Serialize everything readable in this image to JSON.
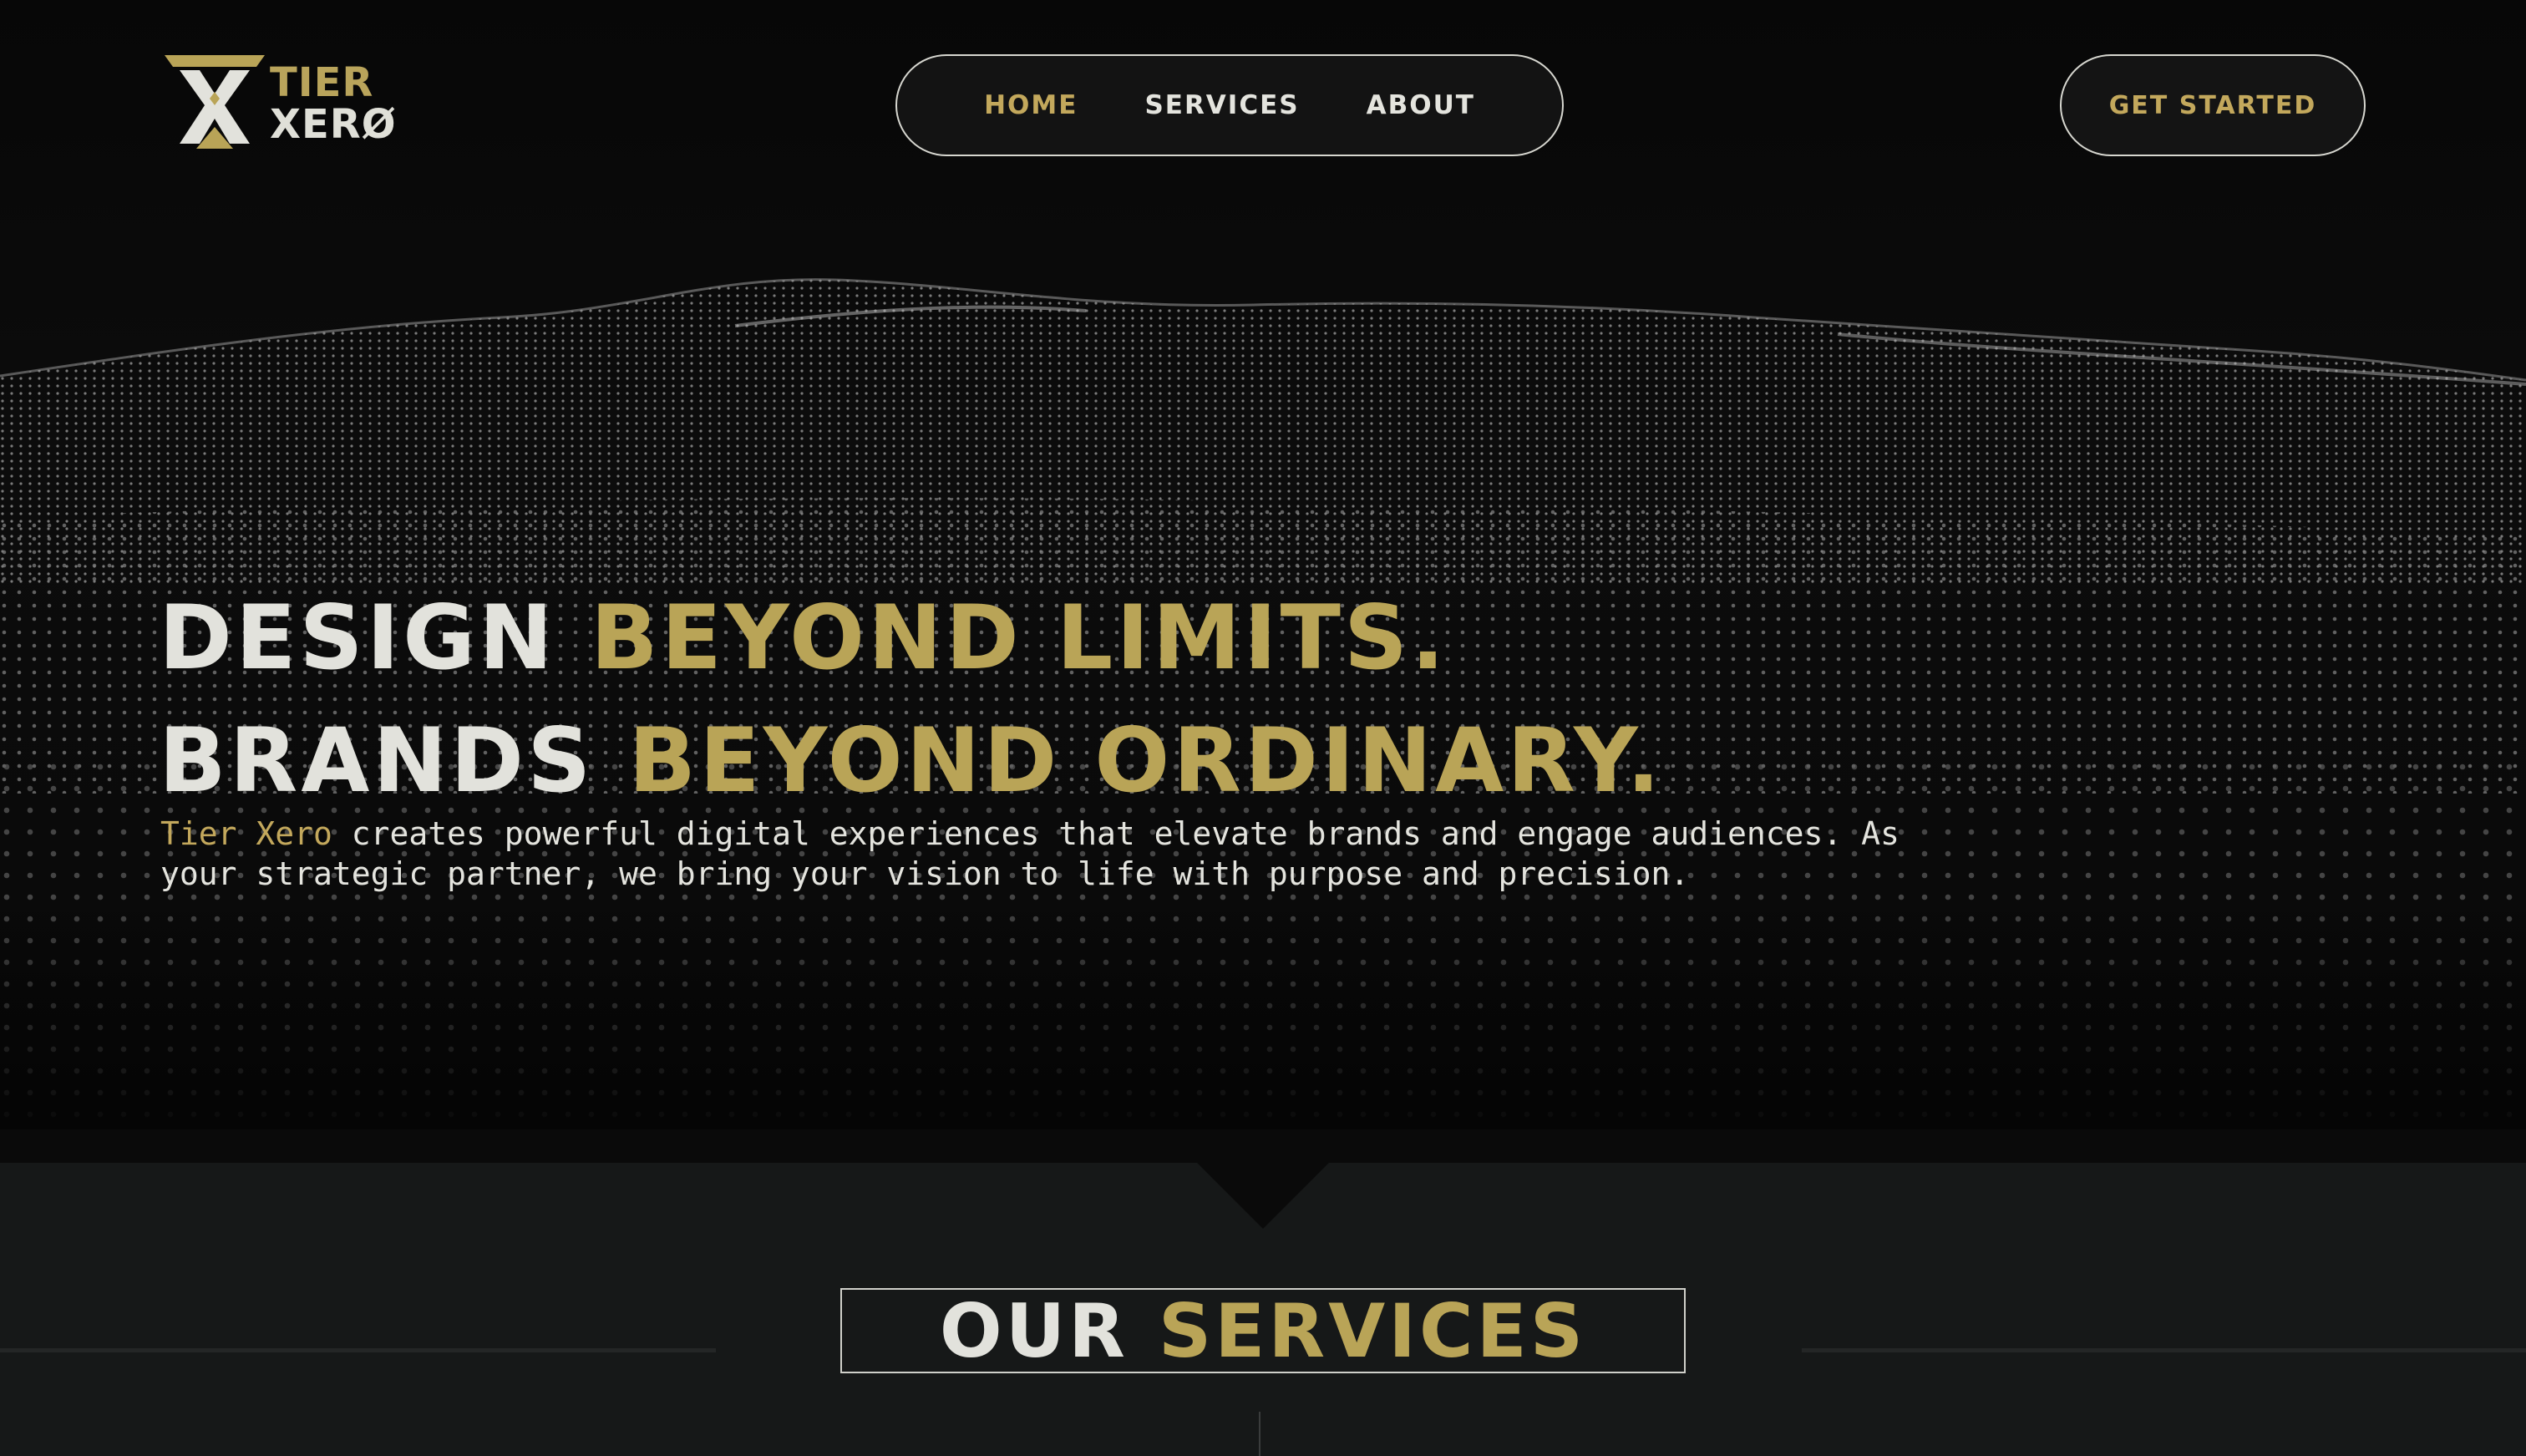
{
  "brand": {
    "logo_line1": "TIER",
    "logo_line2": "XERØ",
    "name": "Tier Xero",
    "accent_color": "#b9a457"
  },
  "nav": {
    "links": [
      {
        "label": "HOME",
        "active": true
      },
      {
        "label": "SERVICES",
        "active": false
      },
      {
        "label": "ABOUT",
        "active": false
      }
    ],
    "cta_label": "GET STARTED"
  },
  "hero": {
    "line1_white": "DESIGN",
    "line1_gold": "BEYOND LIMITS.",
    "line2_white": "BRANDS",
    "line2_gold": "BEYOND ORDINARY.",
    "tagline_brand": "Tier Xero",
    "tagline_rest": " creates powerful digital experiences that elevate brands and engage audiences. As your strategic partner, we bring your vision to life with purpose and precision."
  },
  "services": {
    "title_white": "OUR",
    "title_gold": "SERVICES"
  },
  "icons": {
    "logo": "tier-xero-logo-icon",
    "background": "dot-wave-background"
  }
}
